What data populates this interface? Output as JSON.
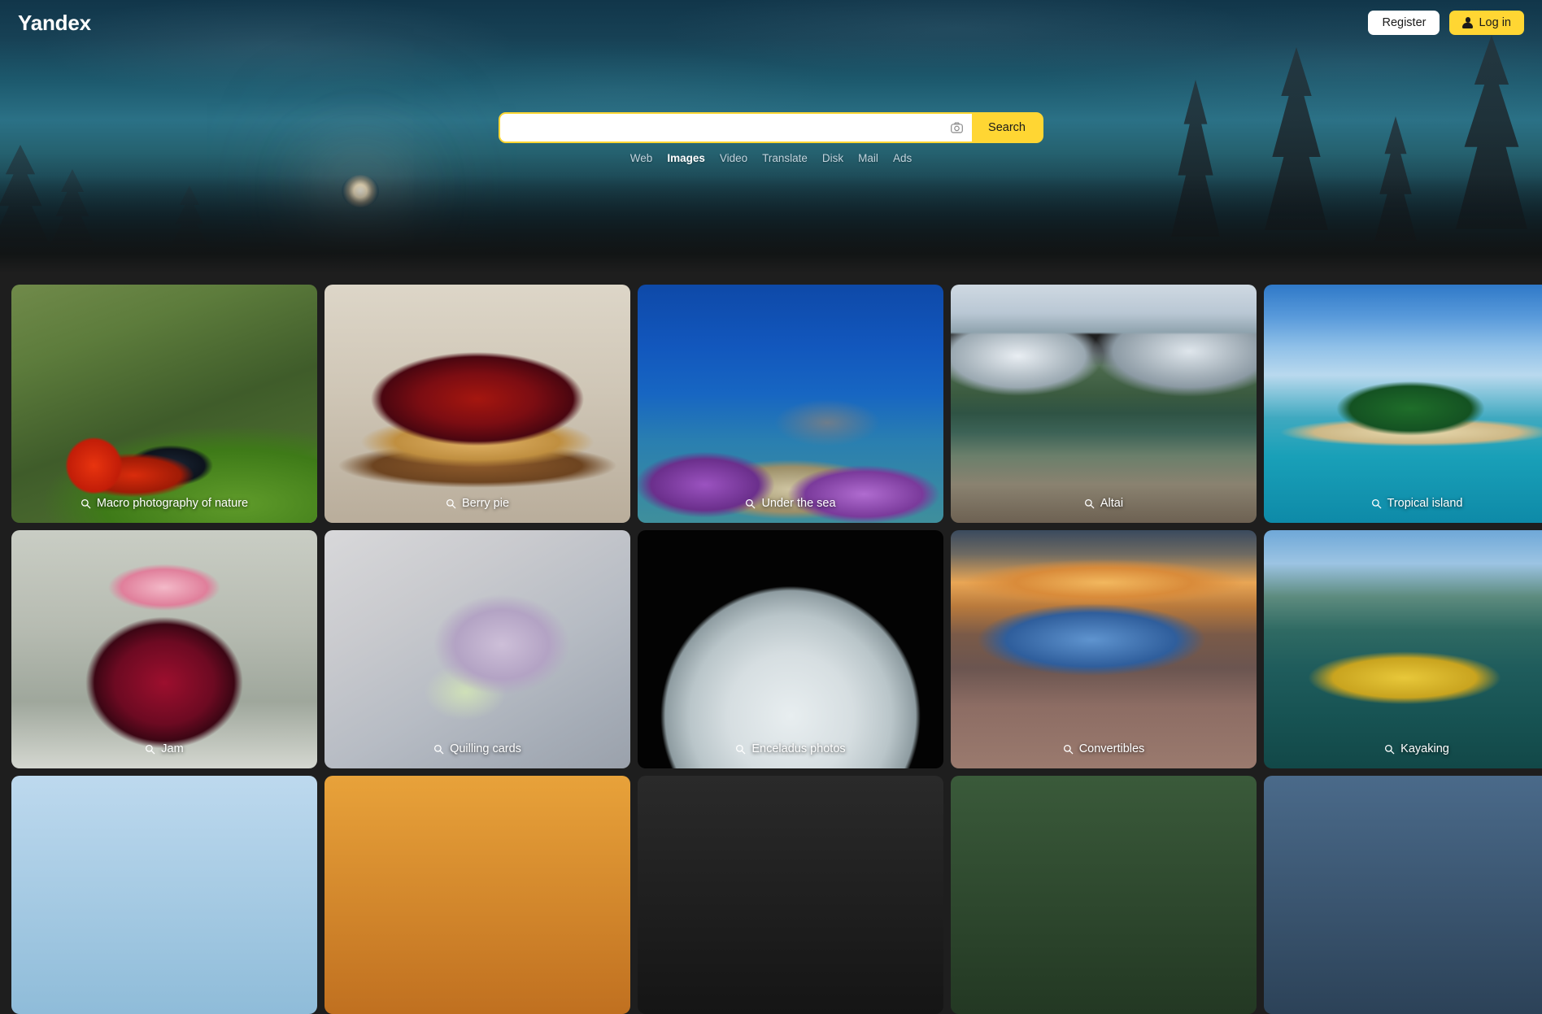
{
  "brand": {
    "logo": "Yandex"
  },
  "topbar": {
    "register_label": "Register",
    "login_label": "Log in",
    "login_icon": "user-icon"
  },
  "search": {
    "value": "",
    "placeholder": "",
    "button_label": "Search",
    "camera_icon": "camera-search-icon",
    "services": [
      {
        "label": "Web",
        "active": false
      },
      {
        "label": "Images",
        "active": true
      },
      {
        "label": "Video",
        "active": false
      },
      {
        "label": "Translate",
        "active": false
      },
      {
        "label": "Disk",
        "active": false
      },
      {
        "label": "Mail",
        "active": false
      },
      {
        "label": "Ads",
        "active": false
      }
    ]
  },
  "gallery": {
    "caption_icon": "search-icon",
    "tiles": [
      {
        "caption": "Macro photography of nature",
        "art": "art-ladybug"
      },
      {
        "caption": "Berry pie",
        "art": "art-pie"
      },
      {
        "caption": "Under the sea",
        "art": "art-sea"
      },
      {
        "caption": "Altai",
        "art": "art-altai"
      },
      {
        "caption": "Tropical island",
        "art": "art-island"
      },
      {
        "caption": "Jam",
        "art": "art-jam"
      },
      {
        "caption": "Quilling cards",
        "art": "art-quilling"
      },
      {
        "caption": "Enceladus photos",
        "art": "art-enceladus"
      },
      {
        "caption": "Convertibles",
        "art": "art-convertible"
      },
      {
        "caption": "Kayaking",
        "art": "art-kayak"
      }
    ]
  },
  "colors": {
    "accent_yellow": "#ffd633",
    "page_background": "#1e1e1e",
    "hero_teal": "#1d5a6e"
  }
}
